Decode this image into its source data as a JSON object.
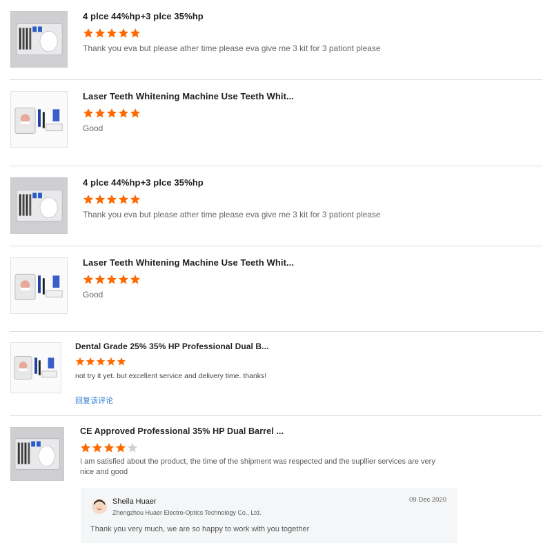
{
  "colors": {
    "star": "#ff6a00",
    "star_empty": "#cfcfcf",
    "link": "#2c7fd4"
  },
  "reviews": [
    {
      "title": "4 plce 44%hp+3 plce 35%hp",
      "rating": 5,
      "text": "Thank you eva but please ather time please eva give me 3 kit for 3 pationt please",
      "thumbnail": "teeth-kit-tray-image"
    },
    {
      "title": "Laser Teeth Whitening Machine Use Teeth Whit...",
      "rating": 5,
      "text": "Good",
      "thumbnail": "whitening-kit-pack-image"
    },
    {
      "title": "4 plce 44%hp+3 plce 35%hp",
      "rating": 5,
      "text": "Thank you eva but please ather time please eva give me 3 kit for 3 pationt please",
      "thumbnail": "teeth-kit-tray-image"
    },
    {
      "title": "Laser Teeth Whitening Machine Use Teeth Whit...",
      "rating": 5,
      "text": "Good",
      "thumbnail": "whitening-kit-pack-image"
    },
    {
      "title": "Dental Grade 25% 35% HP Professional Dual B...",
      "rating": 5,
      "text": "not try it yet. but excellent service and delivery time. thanks!",
      "reply_link": "回复该评论",
      "thumbnail": "whitening-kit-pack-image"
    },
    {
      "title": "CE Approved Professional 35% HP Dual Barrel ...",
      "rating": 4,
      "text_line1": "I am satisfied about the product, the time of the shipment was respected and the supllier services are very",
      "text_line2": "nice and good",
      "thumbnail": "teeth-kit-tray-image"
    }
  ],
  "reply": {
    "name": "Sheila Huaer",
    "company": "Zhengzhou Huaer Electro-Optics Technology Co., Ltd.",
    "date": "09 Dec 2020",
    "text": "Thank you very much,  we are so happy to work with you together"
  }
}
